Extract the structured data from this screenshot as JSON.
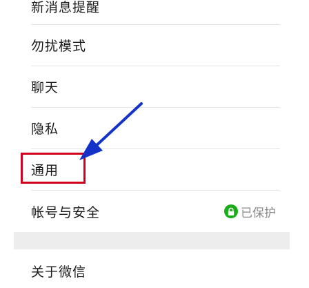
{
  "settings": {
    "items": [
      {
        "label": "新消息提醒"
      },
      {
        "label": "勿扰模式"
      },
      {
        "label": "聊天"
      },
      {
        "label": "隐私"
      },
      {
        "label": "通用"
      },
      {
        "label": "帐号与安全",
        "status": "已保护",
        "status_icon": "lock-icon"
      }
    ],
    "about": {
      "label": "关于微信"
    }
  },
  "colors": {
    "highlight": "#d0021b",
    "arrow": "#1432c8",
    "status_icon": "#1aad19",
    "section_gap": "#ededed"
  }
}
